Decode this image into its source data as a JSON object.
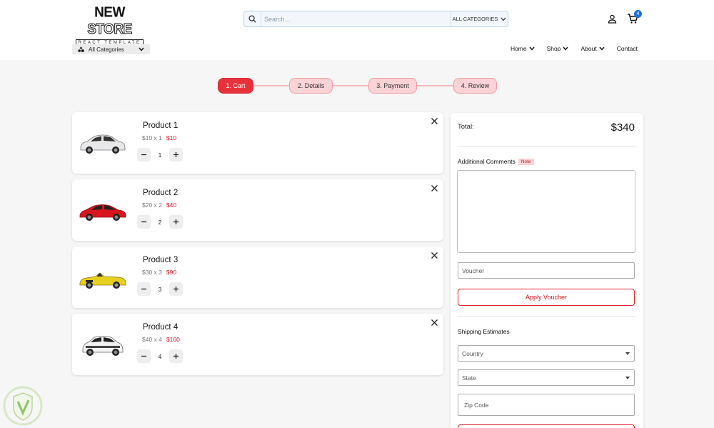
{
  "brand": {
    "title_a": "NEW",
    "title_b": "STORE",
    "subtitle": "REACT TEMPLATE"
  },
  "search": {
    "placeholder": "Search...",
    "category": "ALL CATEGORIES"
  },
  "cart": {
    "count": "4"
  },
  "categories_dropdown": {
    "label": "All Categories"
  },
  "nav": {
    "home": "Home",
    "shop": "Shop",
    "about": "About",
    "contact": "Contact"
  },
  "steps": [
    {
      "label": "1. Cart",
      "active": true
    },
    {
      "label": "2. Details",
      "active": false
    },
    {
      "label": "3. Payment",
      "active": false
    },
    {
      "label": "4. Review",
      "active": false
    }
  ],
  "products": [
    {
      "name": "Product 1",
      "unit": "$10 x 1",
      "total": "$10",
      "qty": "1",
      "car_color": "#e8e8ea"
    },
    {
      "name": "Product 2",
      "unit": "$20 x 2",
      "total": "$40",
      "qty": "2",
      "car_color": "#d8141c"
    },
    {
      "name": "Product 3",
      "unit": "$30 x 3",
      "total": "$90",
      "qty": "3",
      "car_color": "#e6cf1e"
    },
    {
      "name": "Product 4",
      "unit": "$40 x 4",
      "total": "$160",
      "qty": "4",
      "car_color": "#f2f2f2"
    }
  ],
  "summary": {
    "total_label": "Total:",
    "total_value": "$340",
    "comments_label": "Additional Comments",
    "note_badge": "Note",
    "voucher_placeholder": "Voucher",
    "apply_label": "Apply Voucher",
    "shipping_label": "Shipping Estimates",
    "country_label": "Country",
    "state_label": "State",
    "zip_label": "Zip Code"
  },
  "colors": {
    "accent": "#e8323b",
    "step_inactive": "#fbd2d5",
    "price_red": "#d5162c",
    "badge_blue": "#1e6fd9"
  }
}
